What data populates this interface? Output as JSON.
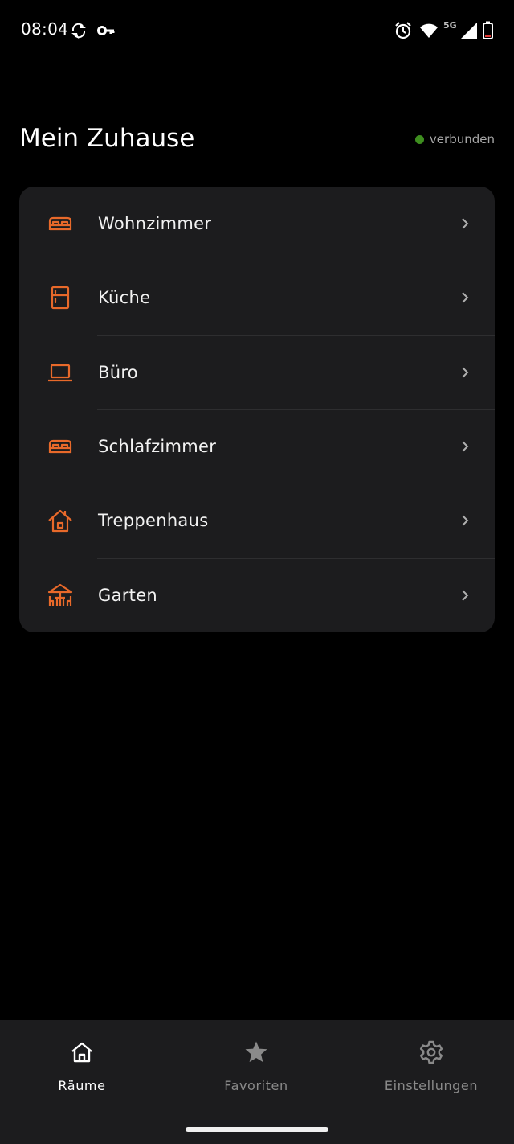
{
  "status_bar": {
    "time": "08:04",
    "network_label": "5G",
    "icons": [
      "sync-icon",
      "key-icon",
      "alarm-icon",
      "wifi-icon",
      "signal-icon",
      "battery-icon"
    ]
  },
  "header": {
    "title": "Mein Zuhause",
    "connection_status": "verbunden",
    "connection_color": "#3e8e1f"
  },
  "accent_color": "#e8692a",
  "rooms": [
    {
      "label": "Wohnzimmer",
      "icon": "sofa-icon"
    },
    {
      "label": "Küche",
      "icon": "fridge-icon"
    },
    {
      "label": "Büro",
      "icon": "laptop-icon"
    },
    {
      "label": "Schlafzimmer",
      "icon": "bed-icon"
    },
    {
      "label": "Treppenhaus",
      "icon": "house-icon"
    },
    {
      "label": "Garten",
      "icon": "garden-table-icon"
    }
  ],
  "bottom_nav": {
    "items": [
      {
        "label": "Räume",
        "icon": "home-icon",
        "active": true
      },
      {
        "label": "Favoriten",
        "icon": "star-icon",
        "active": false
      },
      {
        "label": "Einstellungen",
        "icon": "gear-icon",
        "active": false
      }
    ]
  }
}
